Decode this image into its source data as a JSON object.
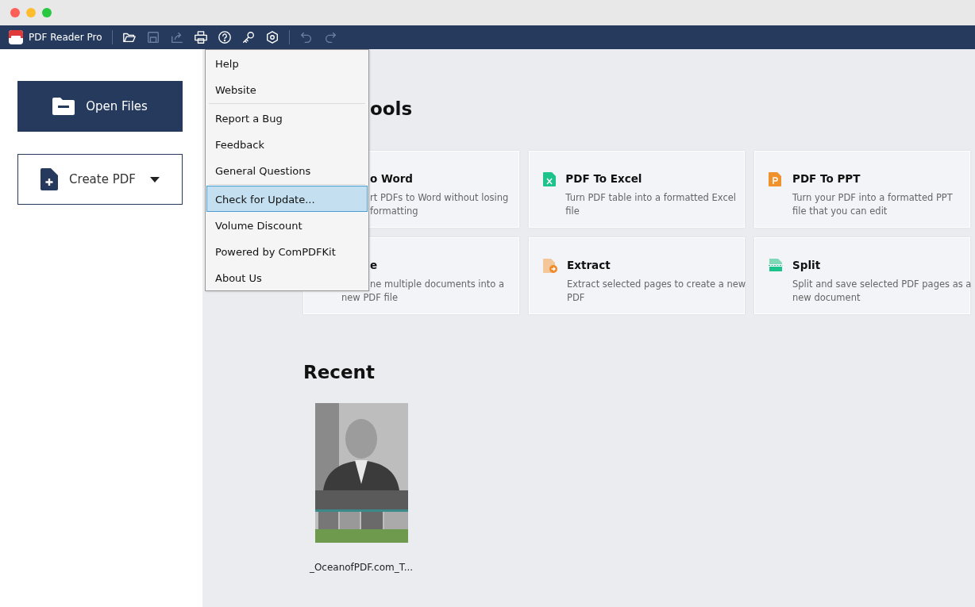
{
  "toolbar": {
    "app_name": "PDF Reader Pro",
    "buttons": [
      {
        "kind": "open",
        "disabled": false
      },
      {
        "kind": "save",
        "disabled": true
      },
      {
        "kind": "share",
        "disabled": true
      },
      {
        "kind": "print",
        "disabled": false
      },
      {
        "kind": "help",
        "disabled": false
      },
      {
        "kind": "key",
        "disabled": false
      },
      {
        "kind": "settings",
        "disabled": false
      },
      {
        "kind": "undo",
        "disabled": true
      },
      {
        "kind": "redo",
        "disabled": true
      }
    ]
  },
  "sidebar": {
    "open_button": "Open Files",
    "create_button": "Create PDF"
  },
  "tools": {
    "heading": {
      "text": "ools",
      "covered": true
    },
    "cards": [
      {
        "title": {
          "text": "o Word",
          "covered": true
        },
        "lines": [
          {
            "text": "rt PDFs to Word without losing",
            "covered": true
          },
          {
            "text": "formatting",
            "covered": true
          }
        ]
      },
      {
        "kind": "excel",
        "title": {
          "text": "PDF To Excel",
          "covered": false
        },
        "lines": [
          {
            "text": "Turn PDF table into a formatted Excel",
            "covered": false
          },
          {
            "text": "file",
            "covered": false
          }
        ]
      },
      {
        "kind": "ppt",
        "title": {
          "text": "PDF To PPT",
          "covered": false
        },
        "lines": [
          {
            "text": "Turn your PDF into a formatted PPT",
            "covered": false
          },
          {
            "text": "file that you can edit",
            "covered": false
          }
        ]
      },
      {
        "title": {
          "text": "e",
          "covered": true
        },
        "lines": [
          {
            "text": "ne multiple documents into a",
            "covered": true
          },
          {
            "text": "new PDF file",
            "covered": false
          }
        ]
      },
      {
        "kind": "extract",
        "title": {
          "text": "Extract",
          "covered": false
        },
        "lines": [
          {
            "text": "Extract selected pages to create a new",
            "covered": false
          },
          {
            "text": "PDF",
            "covered": false
          }
        ]
      },
      {
        "kind": "split",
        "title": {
          "text": "Split",
          "covered": false
        },
        "lines": [
          {
            "text": "Split and save selected PDF pages as a",
            "covered": false
          },
          {
            "text": "new document",
            "covered": false
          }
        ]
      }
    ]
  },
  "recent": {
    "heading": "Recent",
    "files": [
      {
        "kind": "picture",
        "name": "_OceanofPDF.com_T..."
      }
    ]
  },
  "help_menu": {
    "groups": [
      [
        {
          "label": "Help",
          "selected": false
        },
        {
          "label": "Website",
          "selected": false
        }
      ],
      [
        {
          "label": "Report a Bug",
          "selected": false
        },
        {
          "label": "Feedback",
          "selected": false
        },
        {
          "label": "General Questions",
          "selected": false
        }
      ],
      [
        {
          "label": "Check for Update...",
          "selected": true
        },
        {
          "label": "Volume Discount",
          "selected": false
        },
        {
          "label": "Powered by ComPDFKit",
          "selected": false
        },
        {
          "label": "About Us",
          "selected": false
        }
      ]
    ]
  }
}
